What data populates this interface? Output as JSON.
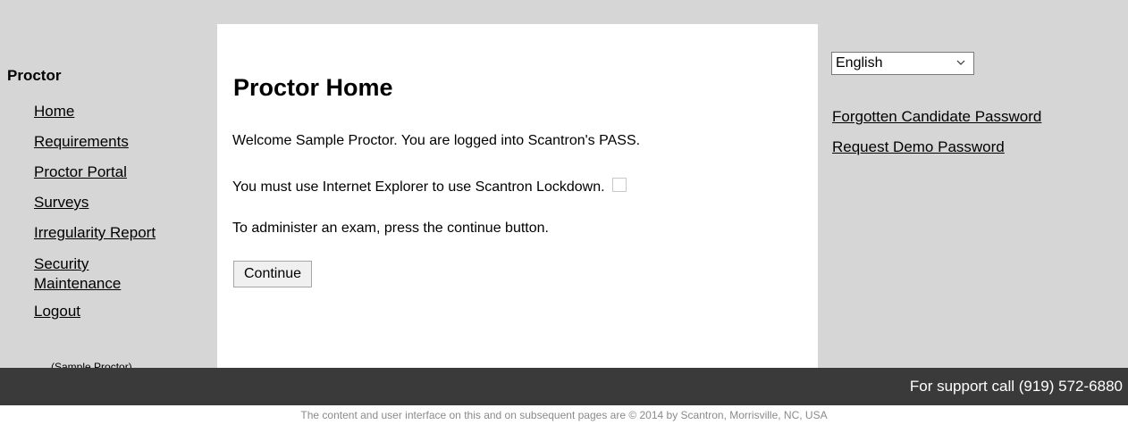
{
  "nav": {
    "heading": "Proctor",
    "items": [
      {
        "label": "Home"
      },
      {
        "label": "Requirements"
      },
      {
        "label": "Proctor Portal"
      },
      {
        "label": "Surveys"
      },
      {
        "label": "Irregularity Report"
      },
      {
        "label": "Security Maintenance"
      },
      {
        "label": "Logout"
      }
    ],
    "user": "(Sample Proctor)"
  },
  "main": {
    "title": "Proctor Home",
    "welcome": "Welcome Sample Proctor. You are logged into Scantron's PASS.",
    "lockdown_note": "You must use Internet Explorer to use Scantron Lockdown.",
    "instruction": "To administer an exam, press the continue button.",
    "continue_label": "Continue"
  },
  "right": {
    "language": {
      "selected": "English"
    },
    "links": [
      {
        "label": "Forgotten Candidate Password"
      },
      {
        "label": "Request Demo Password"
      }
    ]
  },
  "footer": {
    "support": "For support call (919) 572-6880",
    "copyright": "The content and user interface on this and on subsequent pages are © 2014 by Scantron, Morrisville, NC, USA"
  },
  "colors": {
    "panel_gray": "#d6d6d6",
    "footer_dark": "#3a3a3a",
    "copyright_gray": "#8a8a8a"
  }
}
